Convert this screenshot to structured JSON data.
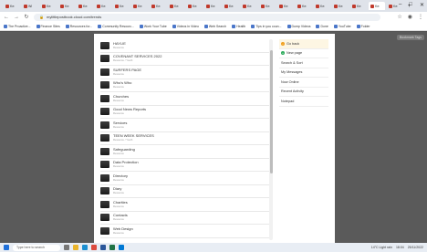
{
  "browser": {
    "tabs": [
      "Ke:",
      "Wi",
      "Ke:",
      "Ke:",
      "Ke:",
      "Ke:",
      "Ke:",
      "Ke:",
      "Ke:",
      "Ke:",
      "Ke:",
      "Ke:",
      "Ke:",
      "Ke:",
      "Ke:",
      "Ke:",
      "Ke:",
      "Ke:",
      "Ke:",
      "Ke:",
      "Ke:",
      "Ke:"
    ],
    "active_tab_index": 20,
    "new_tab": "+",
    "window_controls": [
      "–",
      "□",
      "✕"
    ],
    "url": "mylittlepostbook.cloud.com/trends",
    "bookmarks": [
      "The Proactive...",
      "Finance Sites",
      "Resources for...",
      "Community Resourc...",
      "Work Your Tube",
      "Videos in Video",
      "Web Search",
      "Health",
      "Tips in you coun...",
      "Dump Videos",
      "Done",
      "YouTube",
      "Folder"
    ],
    "tooltip": "Bookmark Tags"
  },
  "list": {
    "items": [
      {
        "title": "HAYLIE",
        "sub": "Resource"
      },
      {
        "title": "COVENANT SERVICES 2022",
        "sub": "Resource / Youth"
      },
      {
        "title": "SURFERS PAGE",
        "sub": "Resource"
      },
      {
        "title": "Who's Who",
        "sub": "Resource"
      },
      {
        "title": "Churches",
        "sub": "Resource"
      },
      {
        "title": "Good News Reports",
        "sub": "Resource"
      },
      {
        "title": "Services",
        "sub": "Resource"
      },
      {
        "title": "TEEN WEEK SERVICES",
        "sub": "Resource / Youth"
      },
      {
        "title": "Safeguarding",
        "sub": "Resource"
      },
      {
        "title": "Data Protection",
        "sub": "Resource"
      },
      {
        "title": "Directory",
        "sub": "Resource"
      },
      {
        "title": "Diary",
        "sub": "Resource"
      },
      {
        "title": "Charities",
        "sub": "Resource"
      },
      {
        "title": "Contacts",
        "sub": "Resource"
      },
      {
        "title": "Web Design",
        "sub": "Resource"
      }
    ]
  },
  "menu": {
    "items": [
      {
        "label": "Go back",
        "icon": "back-icon",
        "color": "#f0a020"
      },
      {
        "label": "New page",
        "icon": "plus-icon",
        "color": "#2eab5c"
      },
      {
        "label": "Search & Sort",
        "icon": "",
        "color": ""
      },
      {
        "label": "My Messages",
        "icon": "",
        "color": ""
      },
      {
        "label": "Now Online",
        "icon": "",
        "color": ""
      },
      {
        "label": "Recent Activity",
        "icon": "",
        "color": ""
      },
      {
        "label": "Notepad",
        "icon": "",
        "color": ""
      }
    ]
  },
  "taskbar": {
    "search_placeholder": "Type here to search",
    "tray_weather": "14°C Light rain",
    "tray_time": "18:04",
    "tray_date": "25/11/2022"
  }
}
